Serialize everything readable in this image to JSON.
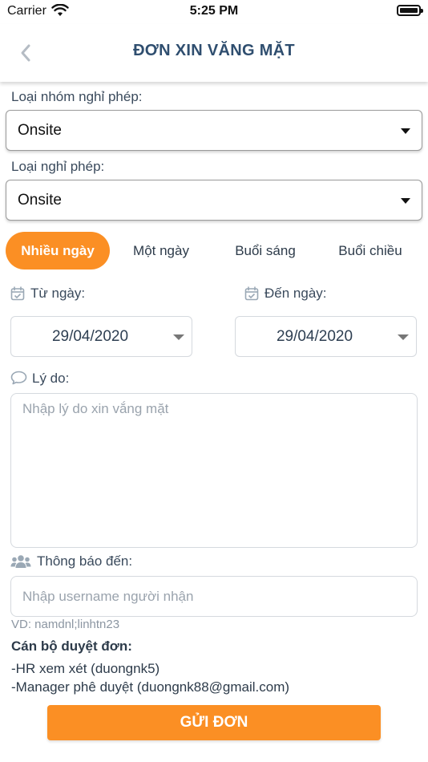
{
  "status_bar": {
    "carrier": "Carrier",
    "time": "5:25 PM"
  },
  "header": {
    "title": "ĐƠN XIN VĂNG MẶT",
    "back_icon": "chevron-left-icon"
  },
  "form": {
    "leave_group": {
      "label": "Loại nhóm nghỉ phép:",
      "value": "Onsite"
    },
    "leave_type": {
      "label": "Loại nghỉ phép:",
      "value": "Onsite"
    },
    "tabs": [
      {
        "label": "Nhiều ngày",
        "active": true
      },
      {
        "label": "Một ngày",
        "active": false
      },
      {
        "label": "Buổi sáng",
        "active": false
      },
      {
        "label": "Buổi chiều",
        "active": false
      }
    ],
    "from_date": {
      "label": "Từ ngày:",
      "value": "29/04/2020"
    },
    "to_date": {
      "label": "Đến ngày:",
      "value": "29/04/2020"
    },
    "reason": {
      "label": "Lý do:",
      "placeholder": "Nhập lý do xin vắng mặt",
      "value": ""
    },
    "notify": {
      "label": "Thông báo đến:",
      "placeholder": "Nhập username người nhận",
      "value": "",
      "example": "VD: namdnl;linhtn23"
    },
    "approvers": {
      "title": "Cán bộ duyệt đơn:",
      "items": [
        "-HR xem xét (duongnk5)",
        "-Manager phê duyệt (duongnk88@gmail.com)"
      ]
    },
    "submit_label": "GỬI ĐƠN"
  },
  "colors": {
    "accent": "#fb8f24",
    "title": "#2f4e6f",
    "text": "#2d3b4a",
    "icon": "#9aa8b5"
  }
}
